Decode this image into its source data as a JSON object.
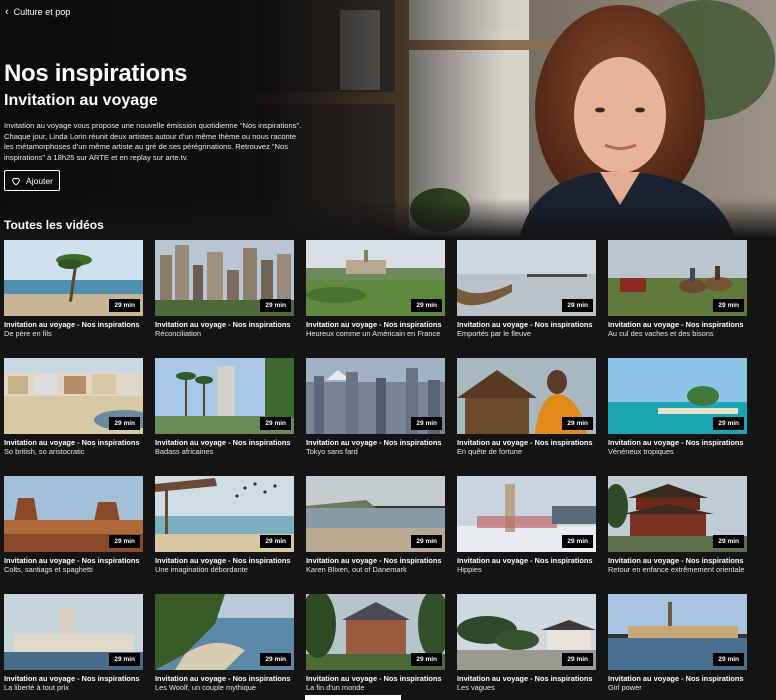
{
  "breadcrumb": {
    "label": "Culture et pop"
  },
  "hero": {
    "title": "Nos inspirations",
    "subtitle": "Invitation au voyage",
    "description": "Invitation au voyage vous propose une nouvelle émission quotidienne “Nos inspirations”. Chaque jour, Linda Lorin réunit deux artistes autour d’un même thème ou nous raconte les métamorphoses d’un même artiste au gré de ses pérégrinations. Retrouvez “Nos inspirations” à 18h25 sur ARTE et en replay sur arte.tv.",
    "add_label": "Ajouter"
  },
  "section": {
    "title": "Toutes les vidéos"
  },
  "videos": [
    {
      "series": "Invitation au voyage - Nos inspirations",
      "title": "De père en fils",
      "duration": "29 min"
    },
    {
      "series": "Invitation au voyage - Nos inspirations",
      "title": "Réconciliation",
      "duration": "29 min"
    },
    {
      "series": "Invitation au voyage - Nos inspirations",
      "title": "Heureux comme un Américain en France",
      "duration": "29 min"
    },
    {
      "series": "Invitation au voyage - Nos inspirations",
      "title": "Emportés par le fleuve",
      "duration": "29 min"
    },
    {
      "series": "Invitation au voyage - Nos inspirations",
      "title": "Au cul des vaches et des bisons",
      "duration": "29 min"
    },
    {
      "series": "Invitation au voyage - Nos inspirations",
      "title": "So british, so aristocratic",
      "duration": "29 min"
    },
    {
      "series": "Invitation au voyage - Nos inspirations",
      "title": "Badass africaines",
      "duration": "29 min"
    },
    {
      "series": "Invitation au voyage - Nos inspirations",
      "title": "Tokyo sans fard",
      "duration": "29 min"
    },
    {
      "series": "Invitation au voyage - Nos inspirations",
      "title": "En quête de fortune",
      "duration": "29 min"
    },
    {
      "series": "Invitation au voyage - Nos inspirations",
      "title": "Vénéneux tropiques",
      "duration": "29 min"
    },
    {
      "series": "Invitation au voyage - Nos inspirations",
      "title": "Colts, santiags et spaghetti",
      "duration": "29 min"
    },
    {
      "series": "Invitation au voyage - Nos inspirations",
      "title": "Une imagination débordante",
      "duration": "29 min"
    },
    {
      "series": "Invitation au voyage - Nos inspirations",
      "title": "Karen Blixen, out of Danemark",
      "duration": "29 min"
    },
    {
      "series": "Invitation au voyage - Nos inspirations",
      "title": "Hippies",
      "duration": "29 min"
    },
    {
      "series": "Invitation au voyage - Nos inspirations",
      "title": "Retour en enfance extrêmement orientale",
      "duration": "29 min"
    },
    {
      "series": "Invitation au voyage - Nos inspirations",
      "title": "La liberté à tout prix",
      "duration": "29 min"
    },
    {
      "series": "Invitation au voyage - Nos inspirations",
      "title": "Les Woolf, un couple mythique",
      "duration": "29 min"
    },
    {
      "series": "Invitation au voyage - Nos inspirations",
      "title": "La fin d'un monde",
      "duration": "29 min"
    },
    {
      "series": "Invitation au voyage - Nos inspirations",
      "title": "Les vagues",
      "duration": "29 min"
    },
    {
      "series": "Invitation au voyage - Nos inspirations",
      "title": "Girl power",
      "duration": "29 min"
    }
  ]
}
